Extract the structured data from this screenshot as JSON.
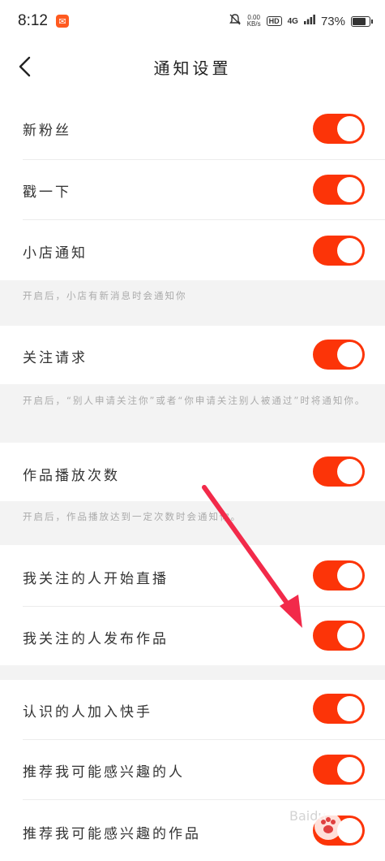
{
  "status_bar": {
    "time": "8:12",
    "net_speed": "0.00",
    "net_unit": "KB/s",
    "hd": "HD",
    "signal": "4G",
    "battery": "73%"
  },
  "header": {
    "title": "通知设置"
  },
  "settings": [
    {
      "label": "新粉丝",
      "enabled": true
    },
    {
      "label": "戳一下",
      "enabled": true
    },
    {
      "label": "小店通知",
      "enabled": true,
      "hint": "开启后，小店有新消息时会通知你"
    },
    {
      "label": "关注请求",
      "enabled": true,
      "hint": "开启后，“别人申请关注你”或者“你申请关注别人被通过”时将通知你。"
    },
    {
      "label": "作品播放次数",
      "enabled": true,
      "hint": "开启后，作品播放达到一定次数时会通知你。"
    },
    {
      "label": "我关注的人开始直播",
      "enabled": true
    },
    {
      "label": "我关注的人发布作品",
      "enabled": true
    },
    {
      "label": "认识的人加入快手",
      "enabled": true
    },
    {
      "label": "推荐我可能感兴趣的人",
      "enabled": true
    },
    {
      "label": "推荐我可能感兴趣的作品",
      "enabled": true
    }
  ],
  "colors": {
    "toggle_on": "#fc3408",
    "arrow": "#f22a4a",
    "section_bg": "#f3f3f3"
  },
  "watermark": "Baidu"
}
